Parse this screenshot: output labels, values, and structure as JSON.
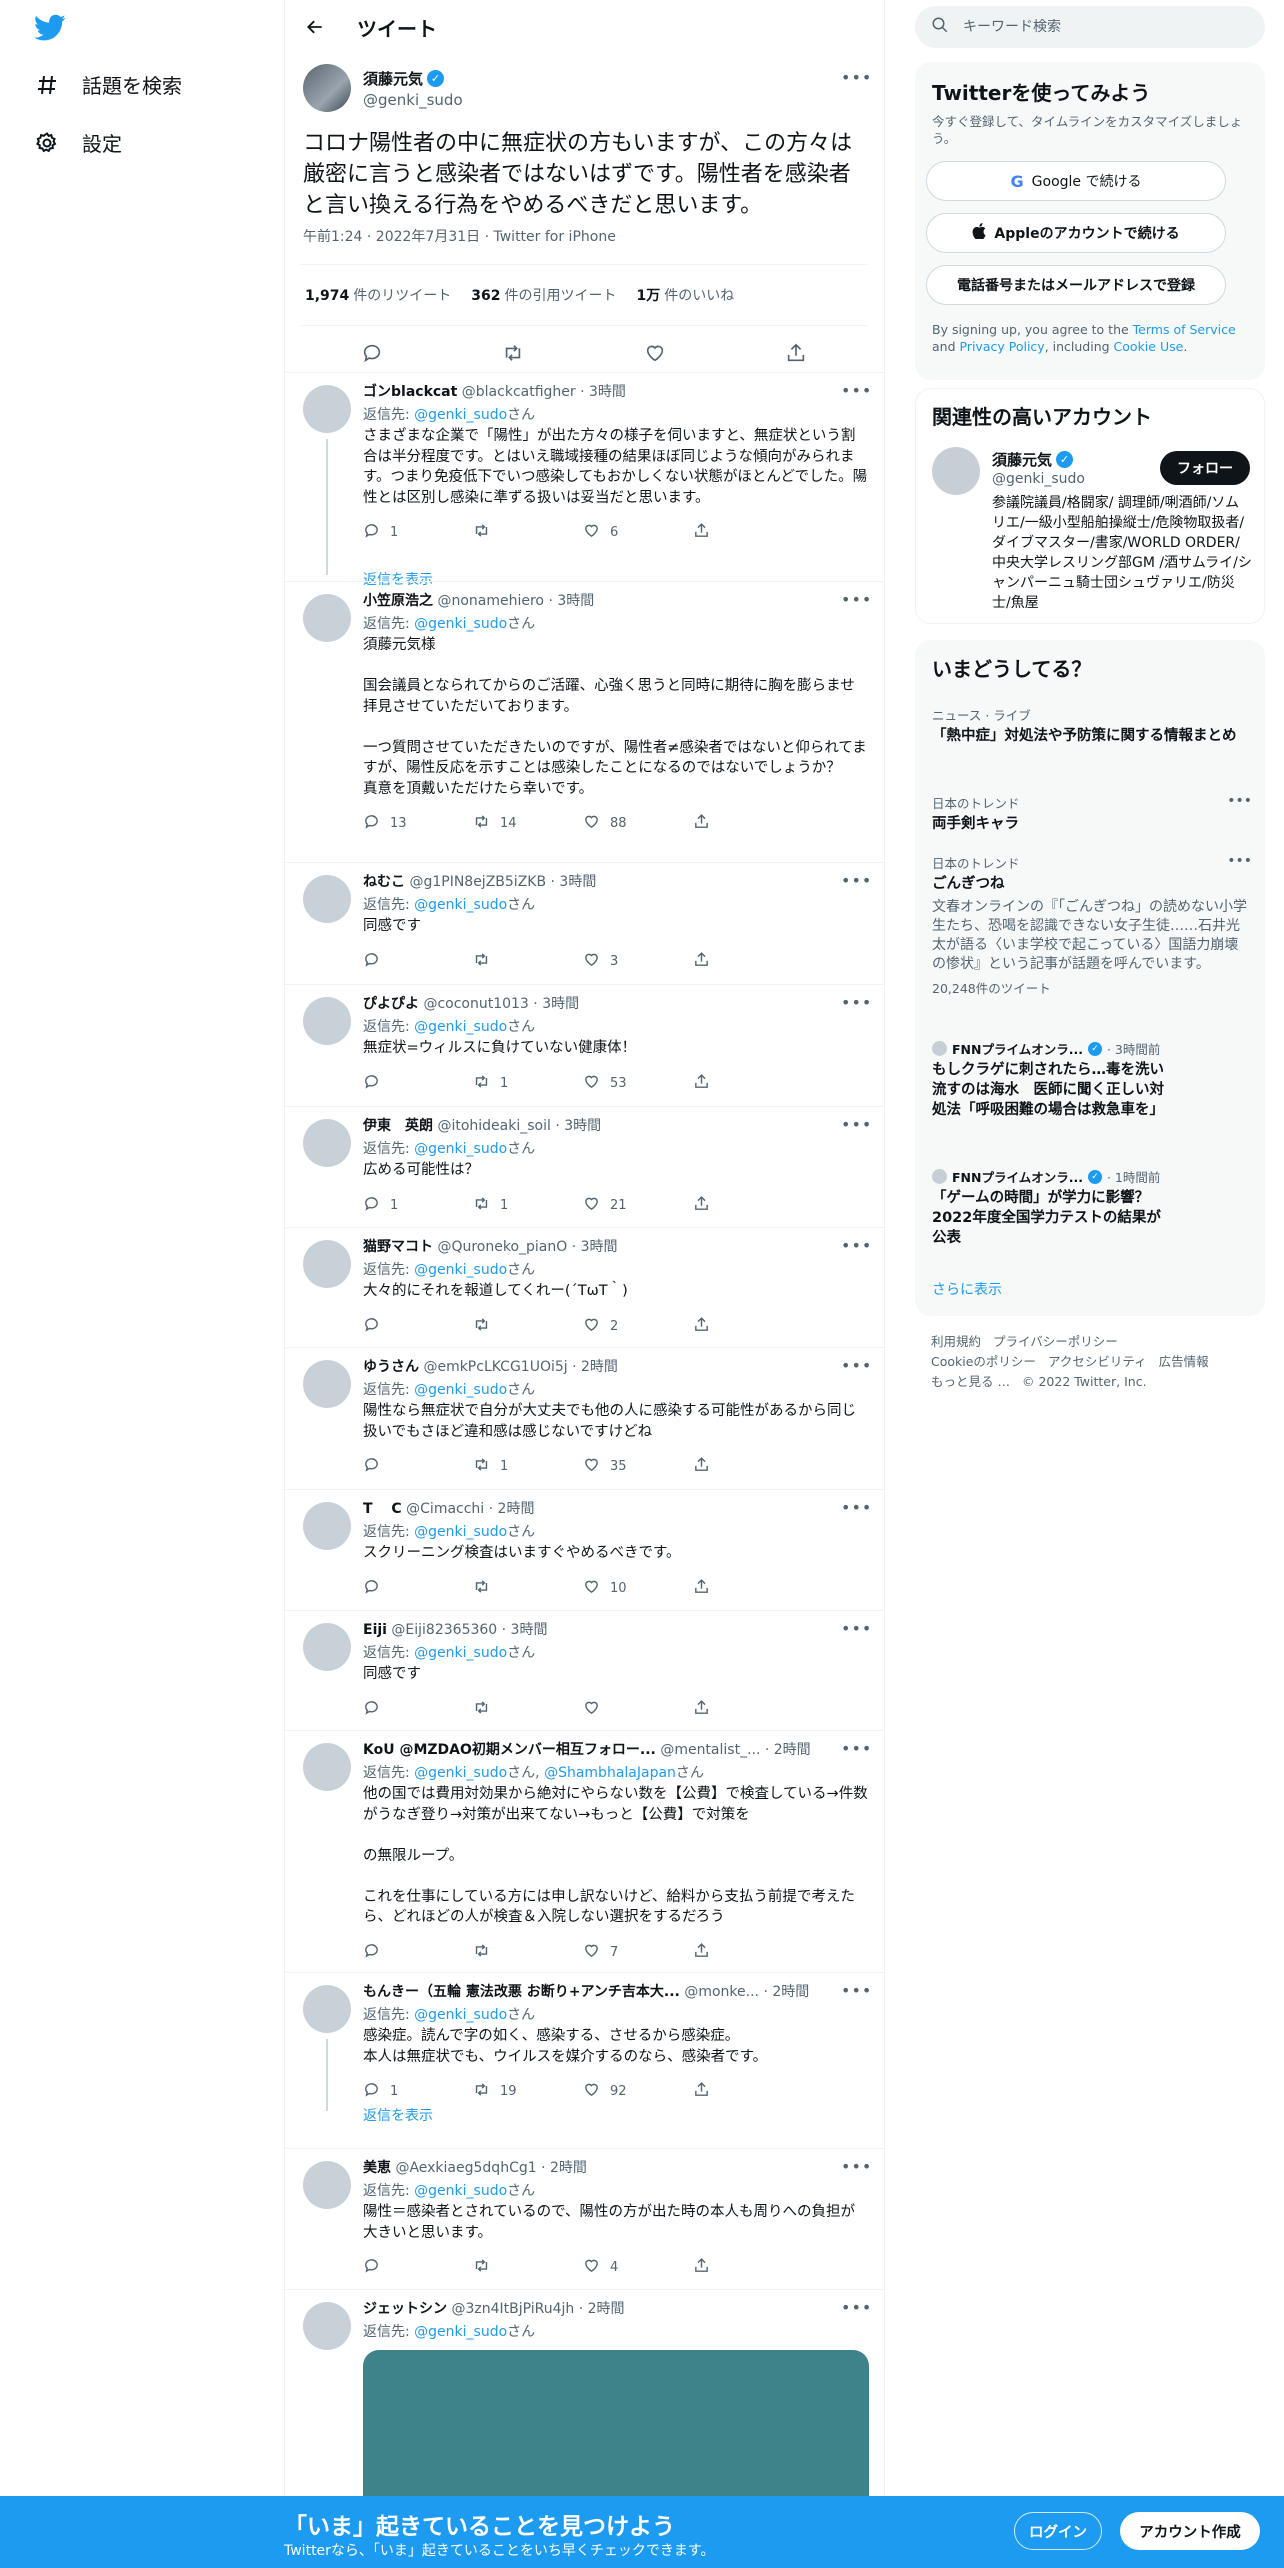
{
  "nav": {
    "explore_label": "話題を検索",
    "settings_label": "設定"
  },
  "header": {
    "title": "ツイート"
  },
  "main_tweet": {
    "name": "須藤元気",
    "handle": "@genki_sudo",
    "text": "コロナ陽性者の中に無症状の方もいますが、この方々は厳密に言うと感染者ではないはずです。陽性者を感染者と言い換える行為をやめるべきだと思います。",
    "meta": "午前1:24 · 2022年7月31日 · Twitter for iPhone",
    "retweets": "1,974",
    "retweets_label": "件のリツイート",
    "quotes": "362",
    "quotes_label": "件の引用ツイート",
    "likes": "1万",
    "likes_label": "件のいいね"
  },
  "reply_to_label": "返信先:",
  "san": "さん",
  "show_replies": "返信を表示",
  "replies": [
    {
      "name": "ゴンblackcat",
      "handle": "@blackcatfigher",
      "time": "· 3時間",
      "to": "@genki_sudo",
      "text": "さまざまな企業で「陽性」が出た方々の様子を伺いますと、無症状という割合は半分程度です。とはいえ職域接種の結果ほぼ同じような傾向がみられます。つまり免疫低下でいつ感染してもおかしくない状態がほとんどでした。陽性とは区別し感染に準ずる扱いは妥当だと思います。",
      "replies": "1",
      "retweets": "",
      "likes": "6"
    },
    {
      "name": "小笠原浩之",
      "handle": "@nonamehiero",
      "time": "· 3時間",
      "to": "@genki_sudo",
      "text": "須藤元気様\n\n国会議員となられてからのご活躍、心強く思うと同時に期待に胸を膨らませ拝見させていただいております。\n\n一つ質問させていただきたいのですが、陽性者≠感染者ではないと仰られてますが、陽性反応を示すことは感染したことになるのではないでしょうか？\n真意を頂戴いただけたら幸いです。",
      "replies": "13",
      "retweets": "14",
      "likes": "88"
    },
    {
      "name": "ねむこ",
      "handle": "@g1PIN8ejZB5iZKB",
      "time": "· 3時間",
      "to": "@genki_sudo",
      "text": "同感です",
      "replies": "",
      "retweets": "",
      "likes": "3"
    },
    {
      "name": "ぴよぴよ",
      "handle": "@coconut1013",
      "time": "· 3時間",
      "to": "@genki_sudo",
      "text": "無症状=ウィルスに負けていない健康体！",
      "replies": "",
      "retweets": "1",
      "likes": "53"
    },
    {
      "name": "伊東　英朗",
      "handle": "@itohideaki_soil",
      "time": "· 3時間",
      "to": "@genki_sudo",
      "text": "広める可能性は？",
      "replies": "1",
      "retweets": "1",
      "likes": "21"
    },
    {
      "name": "猫野マコト",
      "handle": "@Quroneko_pianO",
      "time": "· 3時間",
      "to": "@genki_sudo",
      "text": "大々的にそれを報道してくれー(´TωT｀)",
      "replies": "",
      "retweets": "",
      "likes": "2"
    },
    {
      "name": "ゆうさん",
      "handle": "@emkPcLKCG1UOi5j",
      "time": "· 2時間",
      "to": "@genki_sudo",
      "text": "陽性なら無症状で自分が大丈夫でも他の人に感染する可能性があるから同じ扱いでもさほど違和感は感じないですけどね",
      "replies": "",
      "retweets": "1",
      "likes": "35"
    },
    {
      "name": "T　 C",
      "handle": "@Cimacchi",
      "time": "· 2時間",
      "to": "@genki_sudo",
      "text": "スクリーニング検査はいますぐやめるべきです。",
      "replies": "",
      "retweets": "",
      "likes": "10"
    },
    {
      "name": "Eiji",
      "handle": "@Eiji82365360",
      "time": "· 3時間",
      "to": "@genki_sudo",
      "text": "同感です",
      "replies": "",
      "retweets": "",
      "likes": ""
    },
    {
      "name": "KoU @MZDAO初期メンバー相互フォロー...",
      "handle": "@mentalist_...",
      "time": "· 2時間",
      "to": "@genki_sudo",
      "to2": "@ShambhalaJapan",
      "text": "他の国では費用対効果から絶対にやらない数を【公費】で検査している→件数がうなぎ登り→対策が出来てない→もっと【公費】で対策を\n\nの無限ループ。\n\nこれを仕事にしている方には申し訳ないけど、給料から支払う前提で考えたら、どれほどの人が検査＆入院しない選択をするだろう",
      "replies": "",
      "retweets": "",
      "likes": "7"
    },
    {
      "name": "もんきー（五輪 憲法改悪 お断り+アンチ吉本大...",
      "handle": "@monke...",
      "time": "· 2時間",
      "to": "@genki_sudo",
      "text": "感染症。読んで字の如く、感染する、させるから感染症。\n本人は無症状でも、ウイルスを媒介するのなら、感染者です。",
      "replies": "1",
      "retweets": "19",
      "likes": "92"
    },
    {
      "name": "美恵",
      "handle": "@Aexkiaeg5dqhCg1",
      "time": "· 2時間",
      "to": "@genki_sudo",
      "text": "陽性＝感染者とされているので、陽性の方が出た時の本人も周りへの負担が大きいと思います。",
      "replies": "",
      "retweets": "",
      "likes": "4"
    },
    {
      "name": "ジェットシン",
      "handle": "@3zn4ItBjPiRu4jh",
      "time": "· 2時間",
      "to": "@genki_sudo",
      "text": "",
      "replies": "",
      "retweets": "",
      "likes": ""
    }
  ],
  "search": {
    "placeholder": "キーワード検索"
  },
  "signup_card": {
    "title": "Twitterを使ってみよう",
    "subtitle": "今すぐ登録して、タイムラインをカスタマイズしましょう。",
    "google": "Google で続ける",
    "apple": "Appleのアカウントで続ける",
    "phone": "電話番号またはメールアドレスで登録",
    "legal_prefix": "By signing up, you agree to the ",
    "terms": "Terms of Service",
    "and": " and ",
    "privacy": "Privacy Policy",
    "including": ", including ",
    "cookie": "Cookie Use",
    "period": "."
  },
  "related": {
    "title": "関連性の高いアカウント",
    "name": "須藤元気",
    "handle": "@genki_sudo",
    "follow": "フォロー",
    "bio": "参議院議員/格闘家/ 調理師/唎酒師/ソムリエ/一級小型船舶操縦士/危険物取扱者/ダイブマスター/書家/WORLD ORDER/中央大学レスリング部GM /酒サムライ/シャンパーニュ騎士団シュヴァリエ/防災士/魚屋"
  },
  "trends": {
    "title": "いまどうしてる？",
    "items": [
      {
        "ctx": "ニュース · ライブ",
        "title": "「熱中症」対処法や予防策に関する情報まとめ"
      },
      {
        "ctx": "日本のトレンド",
        "title": "両手剣キャラ"
      },
      {
        "ctx": "日本のトレンド",
        "title": "ごんぎつね",
        "desc": "文春オンラインの『「ごんぎつね」の読めない小学生たち、恐喝を認識できない女子生徒……石井光太が語る〈いま学校で起こっている〉国語力崩壊の惨状』という記事が話題を呼んでいます。",
        "count": "20,248件のツイート"
      },
      {
        "ctx": "FNNプライムオンラ...",
        "time": "· 3時間前",
        "title": "もしクラゲに刺されたら…毒を洗い流すのは海水　医師に聞く正しい対処法「呼吸困難の場合は救急車を」"
      },
      {
        "ctx": "FNNプライムオンラ...",
        "time": "· 1時間前",
        "title": "「ゲームの時間」が学力に影響？ 2022年度全国学力テストの結果が公表"
      }
    ],
    "show_more": "さらに表示"
  },
  "footer": {
    "tos": "利用規約",
    "privacy": "プライバシーポリシー",
    "cookie": "Cookieのポリシー",
    "access": "アクセシビリティ",
    "ads": "広告情報",
    "more": "もっと見る …",
    "copy": "© 2022 Twitter, Inc."
  },
  "bottom": {
    "title": "「いま」起きていることを見つけよう",
    "subtitle": "Twitterなら、「いま」起きていることをいち早くチェックできます。",
    "login": "ログイン",
    "signup": "アカウント作成"
  },
  "colors": {
    "accent": "#1d9bf0",
    "text": "#0f1419",
    "secondary": "#536471"
  }
}
